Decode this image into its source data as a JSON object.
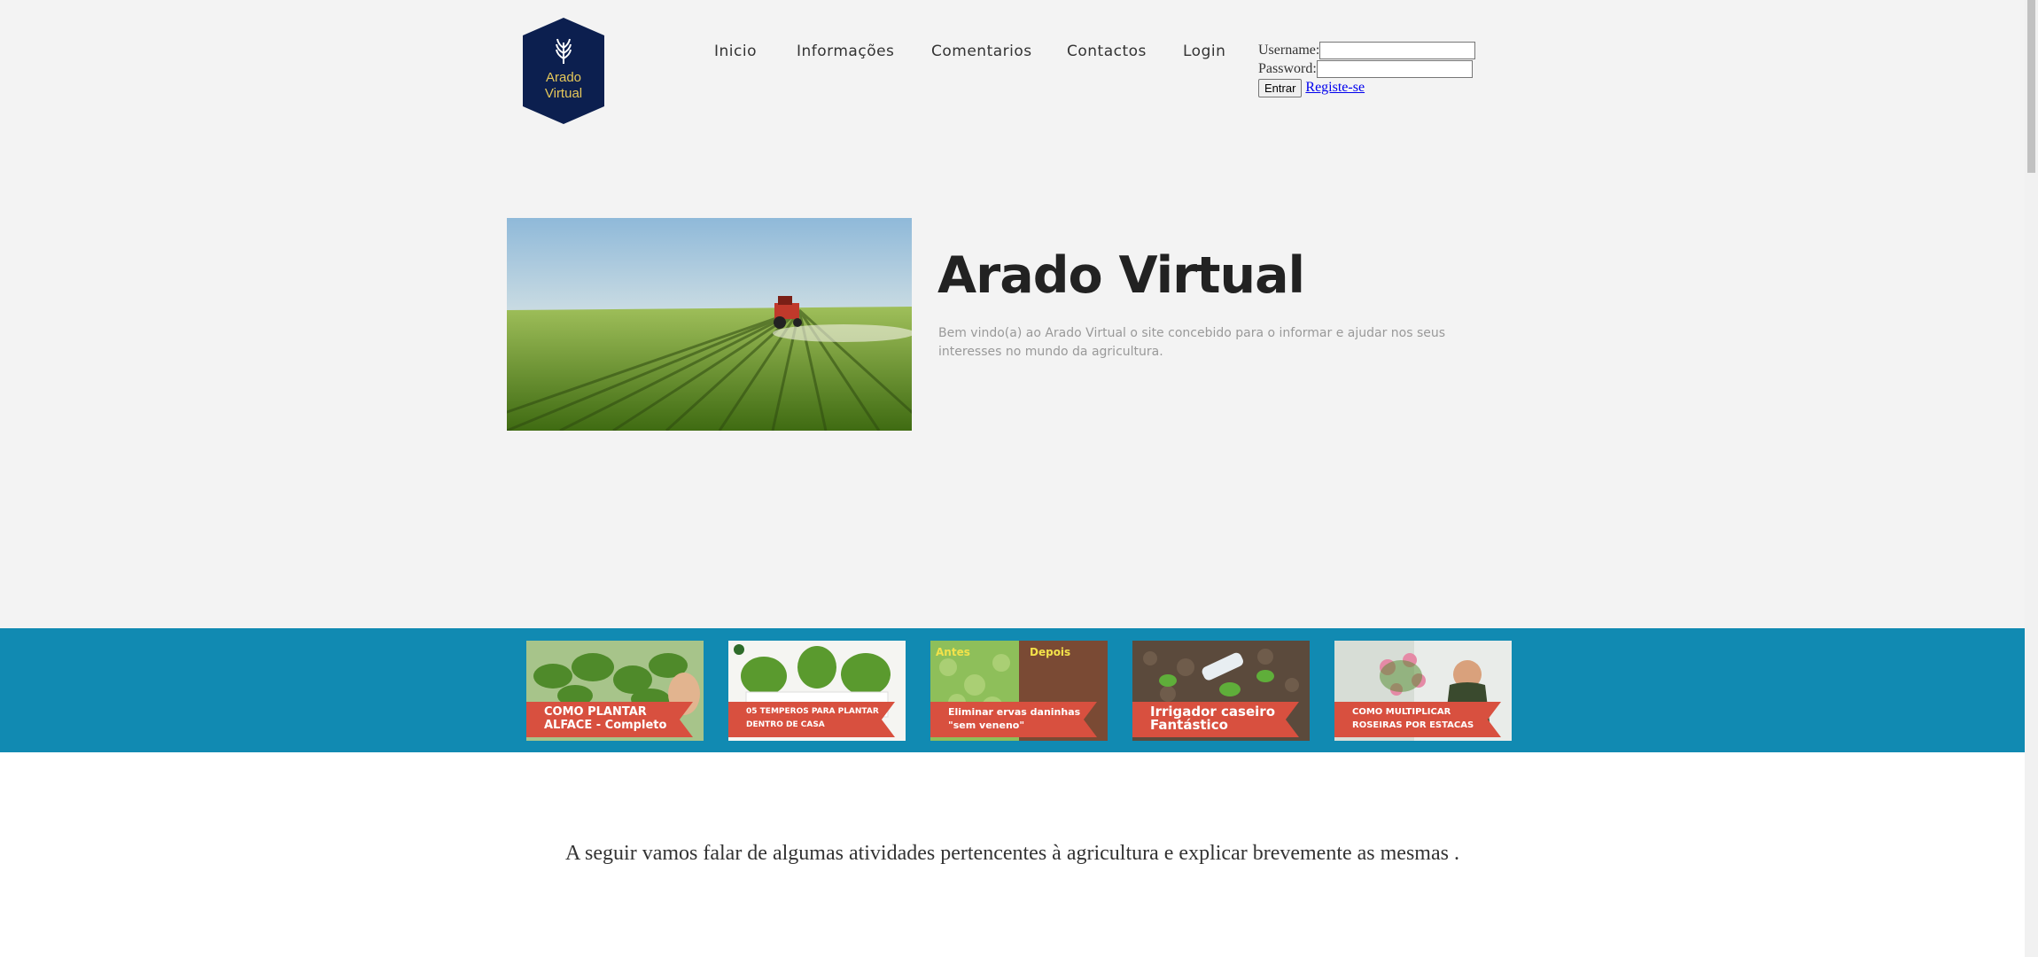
{
  "brand": {
    "logo_text_line1": "Arado",
    "logo_text_line2": "Virtual"
  },
  "nav": {
    "items": [
      {
        "label": "Inicio"
      },
      {
        "label": "Informações"
      },
      {
        "label": "Comentarios"
      },
      {
        "label": "Contactos"
      },
      {
        "label": "Login"
      }
    ]
  },
  "login_form": {
    "username_label": "Username:",
    "username_value": "",
    "password_label": "Password:",
    "password_value": "",
    "submit_label": "Entrar",
    "register_link": "Registe-se"
  },
  "hero": {
    "title": "Arado Virtual",
    "text": "Bem vindo(a) ao Arado Virtual o site concebido para o informar e ajudar nos seus interesses no mundo da agricultura."
  },
  "videos": [
    {
      "caption": "COMO PLANTAR ALFACE - Completo"
    },
    {
      "caption": "05 TEMPEROS PARA PLANTAR DENTRO DE CASA"
    },
    {
      "caption": "Eliminar ervas daninhas \"sem veneno\"",
      "tag_before": "Antes",
      "tag_after": "Depois"
    },
    {
      "caption": "Irrigador caseiro Fantástico"
    },
    {
      "caption": "COMO MULTIPLICAR ROSEIRAS POR ESTACAS"
    }
  ],
  "intro": {
    "text": "A seguir vamos falar de algumas atividades pertencentes à agricultura e explicar brevemente as mesmas ."
  },
  "colors": {
    "band": "#118ab2",
    "ribbon": "#d8503f",
    "logo": "#0c1f4f",
    "logo_text": "#e6c85a"
  }
}
